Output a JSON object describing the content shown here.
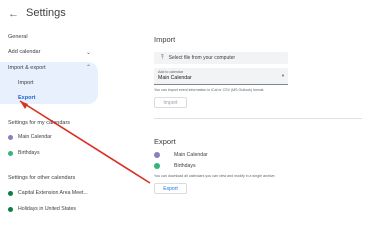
{
  "header": {
    "title": "Settings",
    "back_icon": "arrow-back-icon"
  },
  "sidebar": {
    "general": "General",
    "add_calendar": "Add calendar",
    "import_export": "Import & export",
    "import": "Import",
    "export": "Export",
    "my_calendars_heading": "Settings for my calendars",
    "my_calendars": [
      {
        "label": "Main Calendar",
        "color": "#8e7cc3"
      },
      {
        "label": "Birthdays",
        "color": "#33b679"
      }
    ],
    "other_calendars_heading": "Settings for other calendars",
    "other_calendars": [
      {
        "label": "Capital Extension Area Meet...",
        "color": "#0b8043"
      },
      {
        "label": "Holidays in United States",
        "color": "#0b8043"
      }
    ]
  },
  "import_card": {
    "heading": "Import",
    "file_button": "Select file from your computer",
    "add_to_label": "Add to calendar",
    "add_to_value": "Main Calendar",
    "help": "You can import event information in iCal or CSV (MS Outlook) format.",
    "button": "Import"
  },
  "export_card": {
    "heading": "Export",
    "calendars": [
      {
        "label": "Main Calendar",
        "color": "#8e7cc3"
      },
      {
        "label": "Birthdays",
        "color": "#33b679"
      }
    ],
    "help": "You can download all calendars you can view and modify in a single archive.",
    "button": "Export"
  },
  "colors": {
    "accent": "#1a73e8",
    "annotation": "#d93025",
    "active_bg": "#e8f0fe"
  }
}
